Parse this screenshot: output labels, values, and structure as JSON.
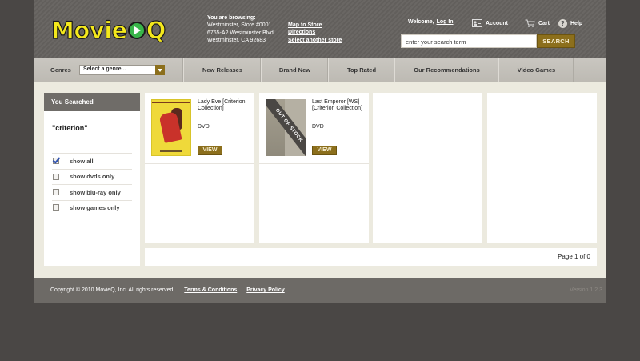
{
  "header": {
    "logo_text_left": "Movie",
    "logo_text_right": "Q",
    "browsing_label": "You are browsing:",
    "store_lines": [
      "Westminster, Store #0001",
      "6765-A2 Westminster Blvd",
      "Westminster, CA 92683"
    ],
    "store_links": [
      "Map to Store",
      "Directions",
      "Select another store"
    ],
    "welcome_text": "Welcome,",
    "login_label": "Log In",
    "account_label": "Account",
    "cart_label": "Cart",
    "help_label": "Help",
    "search": {
      "placeholder": "enter your search term",
      "button_label": "SEARCH"
    }
  },
  "nav": {
    "genres_label": "Genres",
    "genre_select": "Select a genre...",
    "items": [
      "New Releases",
      "Brand New",
      "Top Rated",
      "Our Recommendations",
      "Video Games"
    ]
  },
  "sidebar": {
    "heading": "You Searched",
    "query": "\"criterion\"",
    "filters": [
      {
        "label": "show all",
        "checked": true
      },
      {
        "label": "show dvds only",
        "checked": false
      },
      {
        "label": "show blu-ray only",
        "checked": false
      },
      {
        "label": "show games only",
        "checked": false
      }
    ]
  },
  "results": [
    {
      "title": "Lady Eve [Criterion Collection]",
      "format": "DVD",
      "button_label": "VIEW",
      "poster_icon": "lady-eve-poster",
      "out_of_stock": false
    },
    {
      "title": "Last Emperor [WS] [Criterion Collection]",
      "format": "DVD",
      "button_label": "VIEW",
      "poster_icon": "last-emperor-poster",
      "out_of_stock": true,
      "overlay_text": "OUT OF STOCK"
    }
  ],
  "pager": {
    "text": "Page 1 of 0"
  },
  "footer": {
    "copyright": "Copyright © 2010 MovieQ, Inc. All rights reserved.",
    "links": [
      "Terms & Conditions",
      "Privacy Policy"
    ],
    "version": "Version 1.2.3"
  },
  "colors": {
    "accent": "#8c6f1c",
    "logo_yellow": "#f4e81c",
    "play_green": "#39b54a"
  }
}
